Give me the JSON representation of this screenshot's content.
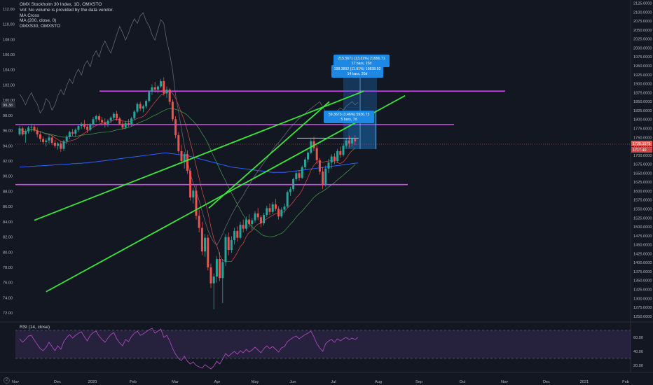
{
  "legend": {
    "title": "OMX Stockholm 30 Index, 1D, OMXSTO",
    "volume_note": "Vol: No volume is provided by the data vendor.",
    "ma_cross": "MA Cross",
    "ma": "MA (200, close, 0)",
    "compare": "OMXS30, OMXSTO"
  },
  "rsi_legend": "RSI (14, close)",
  "corner_button": "2",
  "colors": {
    "background": "#131722",
    "up": "#26a69a",
    "down": "#ef5350",
    "channel": "#39e639",
    "levels": "#e040fb",
    "ma200": "#2962ff",
    "compare_line": "#787b86",
    "rsi": "#ab47bc",
    "measure": "#1e88e5"
  },
  "chart_data": [
    {
      "type": "candlestick",
      "title": "OMX Stockholm 30 Index, 1D, OMXSTO",
      "left_axis_ticks": [
        "112.00",
        "110.00",
        "108.00",
        "106.00",
        "104.00",
        "102.00",
        "100.00",
        "98.00",
        "96.00",
        "94.00",
        "92.00",
        "90.00",
        "88.00",
        "86.00",
        "84.00",
        "82.00",
        "80.00",
        "78.00",
        "76.00",
        "74.00",
        "72.00"
      ],
      "right_axis_ticks": [
        "2125.0000",
        "2100.0000",
        "2075.0000",
        "2050.0000",
        "2025.0000",
        "2000.0000",
        "1975.0000",
        "1950.0000",
        "1925.0000",
        "1900.0000",
        "1875.0000",
        "1850.0000",
        "1825.0000",
        "1800.0000",
        "1775.0000",
        "1750.0000",
        "1725.0000",
        "1700.0000",
        "1675.0000",
        "1650.0000",
        "1625.0000",
        "1600.0000",
        "1575.0000",
        "1550.0000",
        "1525.0000",
        "1500.0000",
        "1475.0000",
        "1450.0000",
        "1425.0000",
        "1400.0000",
        "1375.0000",
        "1350.0000",
        "1325.0000",
        "1300.0000",
        "1275.0000",
        "1250.0000"
      ],
      "x_ticks": [
        "Nov",
        "Dec",
        "2020",
        "Feb",
        "Mar",
        "Apr",
        "May",
        "Jun",
        "Jul",
        "Aug",
        "Sep",
        "Oct",
        "Nov",
        "Dec",
        "2021",
        "Feb"
      ],
      "left_ylim": [
        71.0,
        113.0
      ],
      "right_ylim": [
        1238,
        2130
      ],
      "current_left_label": "99.38",
      "price_labels": [
        "1725.1575",
        "1717.40"
      ],
      "horizontal_levels": [
        101.2,
        96.8,
        88.9
      ],
      "channel": {
        "upper": [
          [
            84.2,
            5
          ],
          [
            101.2,
            117
          ]
        ],
        "lower": [
          [
            74.8,
            9
          ],
          [
            100.6,
            131
          ]
        ],
        "upper_offset_ticks": 11,
        "lower_offset_ticks": 13
      },
      "rectangle_level": 95.0,
      "measure_labels": [
        {
          "line1": "215.5671 (13.31%) 21956.71",
          "line2": "17 bars, 23d"
        },
        {
          "line1": "198.3892 (11.91%) 19838.92",
          "line2": "14 bars, 20d"
        },
        {
          "line1": "59.3673 (3.46%) 5936.73",
          "line2": "5 bars, 7d"
        }
      ],
      "candles": [
        [
          95.5,
          96.6,
          95.3,
          96.3
        ],
        [
          96.3,
          96.5,
          95.3,
          95.5
        ],
        [
          95.5,
          96.2,
          94.4,
          95.9
        ],
        [
          95.9,
          96.6,
          95.6,
          96.4
        ],
        [
          96.4,
          96.9,
          95.8,
          96.5
        ],
        [
          96.5,
          96.7,
          95.8,
          96.0
        ],
        [
          96.0,
          96.4,
          95.1,
          95.5
        ],
        [
          95.5,
          95.9,
          94.5,
          94.9
        ],
        [
          94.9,
          95.2,
          94.2,
          94.5
        ],
        [
          94.5,
          95.0,
          93.9,
          94.7
        ],
        [
          94.7,
          95.5,
          94.3,
          95.1
        ],
        [
          95.1,
          95.4,
          94.1,
          94.4
        ],
        [
          94.4,
          94.8,
          93.7,
          94.0
        ],
        [
          94.0,
          94.5,
          93.5,
          94.3
        ],
        [
          94.3,
          94.6,
          93.2,
          93.6
        ],
        [
          93.6,
          94.8,
          93.3,
          94.6
        ],
        [
          94.6,
          95.4,
          94.2,
          95.2
        ],
        [
          95.2,
          96.0,
          94.9,
          95.8
        ],
        [
          95.8,
          96.2,
          95.3,
          95.6
        ],
        [
          95.6,
          96.3,
          95.2,
          96.1
        ],
        [
          96.1,
          96.8,
          95.8,
          96.6
        ],
        [
          96.6,
          97.1,
          96.2,
          96.9
        ],
        [
          96.9,
          97.4,
          96.2,
          96.5
        ],
        [
          96.5,
          96.9,
          95.7,
          96.1
        ],
        [
          96.1,
          97.0,
          95.9,
          96.8
        ],
        [
          96.8,
          97.8,
          96.5,
          97.5
        ],
        [
          97.5,
          98.1,
          97.1,
          97.9
        ],
        [
          97.9,
          98.2,
          97.1,
          97.4
        ],
        [
          97.4,
          97.8,
          96.7,
          97.1
        ],
        [
          97.1,
          97.6,
          96.4,
          96.8
        ],
        [
          96.8,
          97.5,
          96.5,
          97.3
        ],
        [
          97.3,
          97.9,
          97.0,
          97.7
        ],
        [
          97.7,
          98.4,
          97.4,
          98.2
        ],
        [
          98.2,
          98.6,
          97.3,
          97.6
        ],
        [
          97.6,
          97.8,
          96.7,
          96.9
        ],
        [
          96.9,
          97.2,
          96.1,
          96.4
        ],
        [
          96.4,
          97.3,
          96.2,
          97.0
        ],
        [
          97.0,
          97.5,
          96.5,
          96.8
        ],
        [
          96.8,
          97.8,
          96.6,
          97.6
        ],
        [
          97.6,
          98.7,
          97.4,
          98.5
        ],
        [
          98.5,
          99.7,
          98.3,
          99.5
        ],
        [
          99.5,
          99.8,
          98.6,
          98.9
        ],
        [
          98.9,
          99.4,
          98.4,
          99.2
        ],
        [
          99.2,
          100.1,
          98.9,
          99.9
        ],
        [
          99.9,
          101.3,
          99.7,
          101.1
        ],
        [
          101.1,
          102.1,
          100.7,
          101.7
        ],
        [
          101.7,
          102.4,
          101.0,
          101.4
        ],
        [
          101.4,
          102.0,
          100.9,
          101.8
        ],
        [
          101.8,
          102.8,
          101.6,
          102.5
        ],
        [
          102.5,
          103.0,
          100.6,
          100.9
        ],
        [
          100.9,
          101.8,
          100.3,
          101.4
        ],
        [
          101.4,
          101.6,
          99.4,
          99.8
        ],
        [
          99.8,
          100.1,
          97.2,
          97.5
        ],
        [
          97.5,
          97.9,
          95.0,
          95.4
        ],
        [
          95.4,
          95.8,
          93.0,
          93.3
        ],
        [
          93.3,
          94.1,
          91.6,
          92.0
        ],
        [
          92.0,
          93.2,
          91.0,
          92.9
        ],
        [
          92.9,
          93.4,
          90.3,
          90.7
        ],
        [
          90.7,
          91.1,
          86.8,
          87.2
        ],
        [
          87.2,
          88.5,
          86.4,
          88.1
        ],
        [
          88.1,
          88.8,
          84.3,
          84.8
        ],
        [
          84.8,
          85.6,
          82.6,
          83.2
        ],
        [
          83.2,
          84.0,
          79.6,
          80.1
        ],
        [
          80.1,
          82.4,
          79.4,
          81.9
        ],
        [
          81.9,
          82.3,
          77.6,
          78.0
        ],
        [
          78.0,
          78.5,
          75.3,
          75.9
        ],
        [
          75.9,
          77.2,
          72.5,
          76.8
        ],
        [
          76.8,
          79.5,
          76.0,
          79.1
        ],
        [
          79.1,
          80.0,
          76.2,
          76.6
        ],
        [
          76.6,
          79.1,
          73.3,
          78.7
        ],
        [
          78.7,
          82.4,
          78.2,
          82.0
        ],
        [
          82.0,
          82.6,
          79.6,
          80.3
        ],
        [
          80.3,
          82.1,
          79.9,
          81.6
        ],
        [
          81.6,
          83.2,
          81.0,
          82.8
        ],
        [
          82.8,
          83.4,
          81.4,
          81.9
        ],
        [
          81.9,
          84.0,
          81.7,
          83.6
        ],
        [
          83.6,
          84.3,
          82.6,
          83.1
        ],
        [
          83.1,
          84.7,
          82.8,
          84.3
        ],
        [
          84.3,
          85.0,
          83.3,
          83.7
        ],
        [
          83.7,
          84.5,
          82.9,
          84.2
        ],
        [
          84.2,
          85.4,
          83.9,
          85.1
        ],
        [
          85.1,
          85.8,
          84.2,
          84.6
        ],
        [
          84.6,
          84.9,
          83.3,
          83.8
        ],
        [
          83.8,
          85.2,
          83.5,
          84.9
        ],
        [
          84.9,
          86.1,
          84.6,
          85.8
        ],
        [
          85.8,
          86.4,
          84.9,
          85.3
        ],
        [
          85.3,
          86.6,
          85.0,
          86.3
        ],
        [
          86.3,
          87.0,
          85.4,
          85.7
        ],
        [
          85.7,
          86.0,
          84.3,
          84.7
        ],
        [
          84.7,
          85.9,
          84.5,
          85.6
        ],
        [
          85.6,
          86.4,
          85.1,
          86.0
        ],
        [
          86.0,
          88.1,
          85.8,
          87.9
        ],
        [
          87.9,
          88.6,
          87.4,
          88.3
        ],
        [
          88.3,
          89.8,
          88.0,
          89.6
        ],
        [
          89.6,
          90.7,
          89.3,
          90.4
        ],
        [
          90.4,
          90.8,
          89.4,
          89.8
        ],
        [
          89.8,
          91.4,
          89.6,
          91.2
        ],
        [
          91.2,
          92.5,
          90.9,
          92.2
        ],
        [
          92.2,
          93.4,
          91.8,
          93.1
        ],
        [
          93.1,
          94.9,
          92.9,
          94.6
        ],
        [
          94.6,
          95.2,
          93.3,
          93.7
        ],
        [
          93.7,
          94.1,
          91.6,
          92.1
        ],
        [
          92.1,
          92.4,
          90.2,
          90.6
        ],
        [
          90.6,
          91.2,
          88.3,
          88.9
        ],
        [
          88.9,
          91.4,
          88.6,
          91.0
        ],
        [
          91.0,
          92.3,
          90.4,
          91.8
        ],
        [
          91.8,
          92.9,
          91.0,
          92.6
        ],
        [
          92.6,
          93.0,
          91.6,
          92.0
        ],
        [
          92.0,
          93.6,
          91.8,
          93.3
        ],
        [
          93.3,
          93.9,
          92.4,
          92.8
        ],
        [
          92.8,
          94.3,
          92.6,
          94.0
        ],
        [
          94.0,
          95.0,
          93.6,
          94.7
        ],
        [
          94.7,
          95.3,
          93.8,
          94.3
        ],
        [
          94.3,
          95.1,
          93.9,
          94.9
        ],
        [
          94.9,
          95.4,
          94.1,
          94.6
        ]
      ],
      "compare_series": [
        100.8,
        100.2,
        99.4,
        100.3,
        101.0,
        100.1,
        99.5,
        98.3,
        98.9,
        100.2,
        99.8,
        98.7,
        99.4,
        100.6,
        101.4,
        100.7,
        101.9,
        102.8,
        102.2,
        103.4,
        104.1,
        103.3,
        104.6,
        105.2,
        104.4,
        105.8,
        106.5,
        105.7,
        107.0,
        107.8,
        106.9,
        106.2,
        107.4,
        108.6,
        109.7,
        108.9,
        107.9,
        108.8,
        109.9,
        110.7,
        110.1,
        111.1,
        111.5,
        110.4,
        109.8,
        108.6,
        107.9,
        109.3,
        110.6,
        110.1,
        107.8,
        106.1,
        103.9,
        100.7,
        98.5,
        96.2,
        94.0,
        92.1,
        90.3,
        89.1,
        88.0,
        86.8,
        85.4,
        84.1,
        82.9,
        82.0,
        81.3,
        80.9,
        81.6,
        82.4,
        83.3,
        84.1,
        84.9,
        85.6,
        86.3,
        86.9,
        87.5,
        88.2,
        88.8,
        89.5,
        90.1,
        90.7,
        91.2,
        91.8,
        92.3,
        92.9,
        93.5,
        94.0,
        94.4,
        94.9,
        95.4,
        95.9,
        96.4,
        96.8,
        97.2,
        97.6,
        97.9,
        98.2,
        98.6,
        98.9,
        99.2,
        99.5,
        99.8,
        99.1,
        98.4,
        98.0,
        97.7,
        98.1,
        98.6,
        99.0,
        98.7,
        99.2,
        99.5,
        99.8,
        99.4,
        99.7
      ],
      "ma200": [
        91.2,
        91.2,
        91.25,
        91.25,
        91.3,
        91.3,
        91.35,
        91.35,
        91.4,
        91.4,
        91.45,
        91.45,
        91.5,
        91.5,
        91.55,
        91.55,
        91.6,
        91.6,
        91.65,
        91.65,
        91.7,
        91.7,
        91.75,
        91.75,
        91.8,
        91.85,
        91.9,
        91.95,
        92.0,
        92.05,
        92.1,
        92.15,
        92.2,
        92.25,
        92.3,
        92.35,
        92.4,
        92.45,
        92.5,
        92.55,
        92.6,
        92.65,
        92.7,
        92.75,
        92.8,
        92.85,
        92.9,
        92.95,
        93.0,
        93.05,
        93.05,
        93.0,
        92.95,
        92.9,
        92.85,
        92.8,
        92.75,
        92.7,
        92.6,
        92.5,
        92.4,
        92.3,
        92.2,
        92.1,
        92.0,
        91.9,
        91.8,
        91.7,
        91.6,
        91.5,
        91.4,
        91.3,
        91.2,
        91.15,
        91.1,
        91.05,
        91.0,
        90.95,
        90.9,
        90.85,
        90.8,
        90.75,
        90.7,
        90.65,
        90.6,
        90.55,
        90.5,
        90.5,
        90.5,
        90.5,
        90.5,
        90.55,
        90.6,
        90.65,
        90.7,
        90.75,
        90.8,
        90.85,
        90.9,
        90.95,
        91.0,
        91.05,
        91.1,
        91.15,
        91.2,
        91.25,
        91.3,
        91.35,
        91.4,
        91.45,
        91.5,
        91.55,
        91.6,
        91.65,
        91.7,
        91.75
      ],
      "rsi_panel": {
        "title": "RSI (14, close)",
        "ticks": [
          "60.00",
          "40.00",
          "20.00"
        ],
        "ylim": [
          12,
          80
        ],
        "bands": [
          70,
          30
        ],
        "values": [
          58,
          53,
          57,
          62,
          63,
          56,
          50,
          44,
          41,
          46,
          53,
          47,
          41,
          48,
          43,
          54,
          60,
          64,
          59,
          63,
          66,
          68,
          61,
          55,
          63,
          67,
          69,
          62,
          57,
          53,
          59,
          64,
          67,
          58,
          52,
          48,
          57,
          54,
          61,
          66,
          69,
          63,
          65,
          68,
          71,
          73,
          66,
          69,
          72,
          60,
          63,
          55,
          44,
          36,
          30,
          27,
          33,
          26,
          22,
          25,
          20,
          18,
          16,
          21,
          18,
          15,
          19,
          26,
          22,
          29,
          37,
          33,
          37,
          40,
          36,
          41,
          38,
          43,
          39,
          42,
          46,
          42,
          38,
          44,
          48,
          44,
          47,
          43,
          39,
          45,
          47,
          54,
          57,
          60,
          62,
          58,
          61,
          64,
          66,
          69,
          61,
          51,
          45,
          40,
          51,
          55,
          57,
          53,
          58,
          55,
          58,
          60,
          57,
          59,
          57,
          60
        ]
      }
    }
  ]
}
